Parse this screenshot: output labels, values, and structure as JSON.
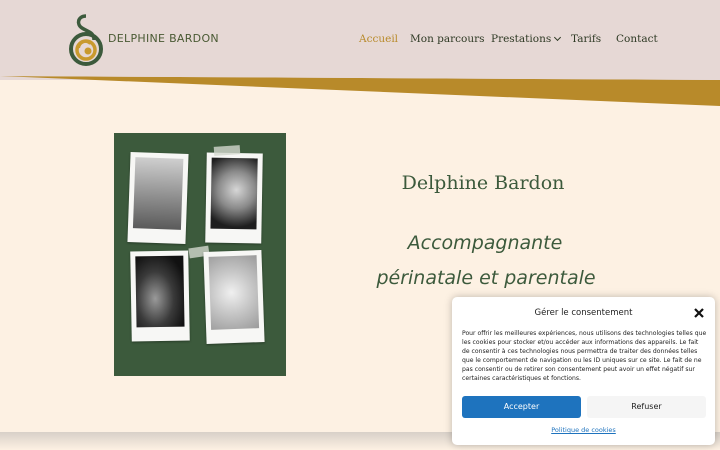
{
  "header": {
    "logo_text": "DELPHINE BARDON",
    "nav": [
      {
        "label": "Accueil",
        "active": true
      },
      {
        "label": "Mon parcours",
        "active": false
      },
      {
        "label": "Prestations",
        "active": false,
        "has_dropdown": true
      },
      {
        "label": "Tarifs",
        "active": false
      },
      {
        "label": "Contact",
        "active": false
      }
    ]
  },
  "hero": {
    "name": "Delphine Bardon",
    "tagline_line1": "Accompagnante",
    "tagline_line2": "périnatale et parentale"
  },
  "consent": {
    "title": "Gérer le consentement",
    "text": "Pour offrir les meilleures expériences, nous utilisons des technologies telles que les cookies pour stocker et/ou accéder aux informations des appareils. Le fait de consentir à ces technologies nous permettra de traiter des données telles que le comportement de navigation ou les ID uniques sur ce site. Le fait de ne pas consentir ou de retirer son consentement peut avoir un effet négatif sur certaines caractéristiques et fonctions.",
    "accept_label": "Accepter",
    "refuse_label": "Refuser",
    "policy_link": "Politique de cookies"
  },
  "colors": {
    "header_bg": "#e6d8d5",
    "page_bg": "#fdf1e3",
    "gold": "#b88a2a",
    "green": "#3c5a3c",
    "accept_blue": "#1e73be"
  }
}
